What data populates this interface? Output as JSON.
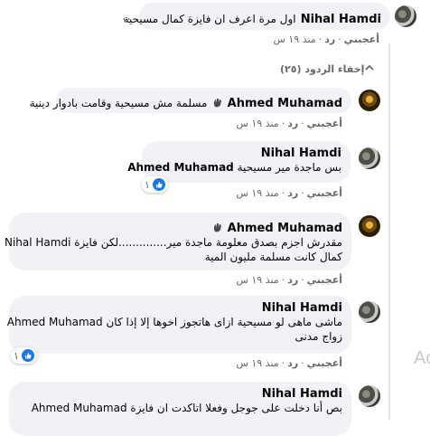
{
  "top_comment": {
    "author": "Nihal Hamdi",
    "text": "اول مرة اعرف ان فايزة كمال مسيحية",
    "more": "...",
    "actions": {
      "like": "أعجبني",
      "reply": "رد",
      "time": "منذ ١٩ س"
    }
  },
  "hide_replies": "إخفاء الردود (٢٥)",
  "replies": [
    {
      "author": "Ahmed Muhamad",
      "text": "مسلمة مش مسيحية وقامت بادوار دينية",
      "actions": {
        "like": "أعجبني",
        "reply": "رد",
        "time": "منذ ١٩ س"
      }
    },
    {
      "author": "Nihal Hamdi",
      "mention": "Ahmed Muhamad",
      "text": "بس ماجدة مير مسيحية",
      "reactions": "١",
      "actions": {
        "like": "أعجبني",
        "reply": "رد",
        "time": "منذ ١٩ س"
      }
    },
    {
      "author": "Ahmed Muhamad",
      "line1": "مقدرش اجزم بصدق معلومة ماجدة مير..............لكن فايزة",
      "mention": "Nihal Hamdi",
      "line2": "كمال كانت مسلمة مليون المية",
      "actions": {
        "like": "أعجبني",
        "reply": "رد",
        "time": "منذ ١٩ س"
      }
    },
    {
      "author": "Nihal Hamdi",
      "mention": "Ahmed Muhamad",
      "line1": "ماشى ماهى لو مسيحية ازاى هاتجوز اخوها إلا إذا كان",
      "line2": "زواج مدنى",
      "reactions": "١",
      "actions": {
        "like": "أعجبني",
        "reply": "رد",
        "time": "منذ ١٩ س"
      }
    },
    {
      "author": "Nihal Hamdi",
      "mention": "Ahmed Muhamad",
      "line1": "بص أنا دخلت على جوجل وفعلا اتاكدت ان فايزة"
    }
  ],
  "watermark": "Ac",
  "colors": {
    "bubble": "#f0f2f5",
    "meta": "#65676b",
    "like": "#1877f2"
  }
}
